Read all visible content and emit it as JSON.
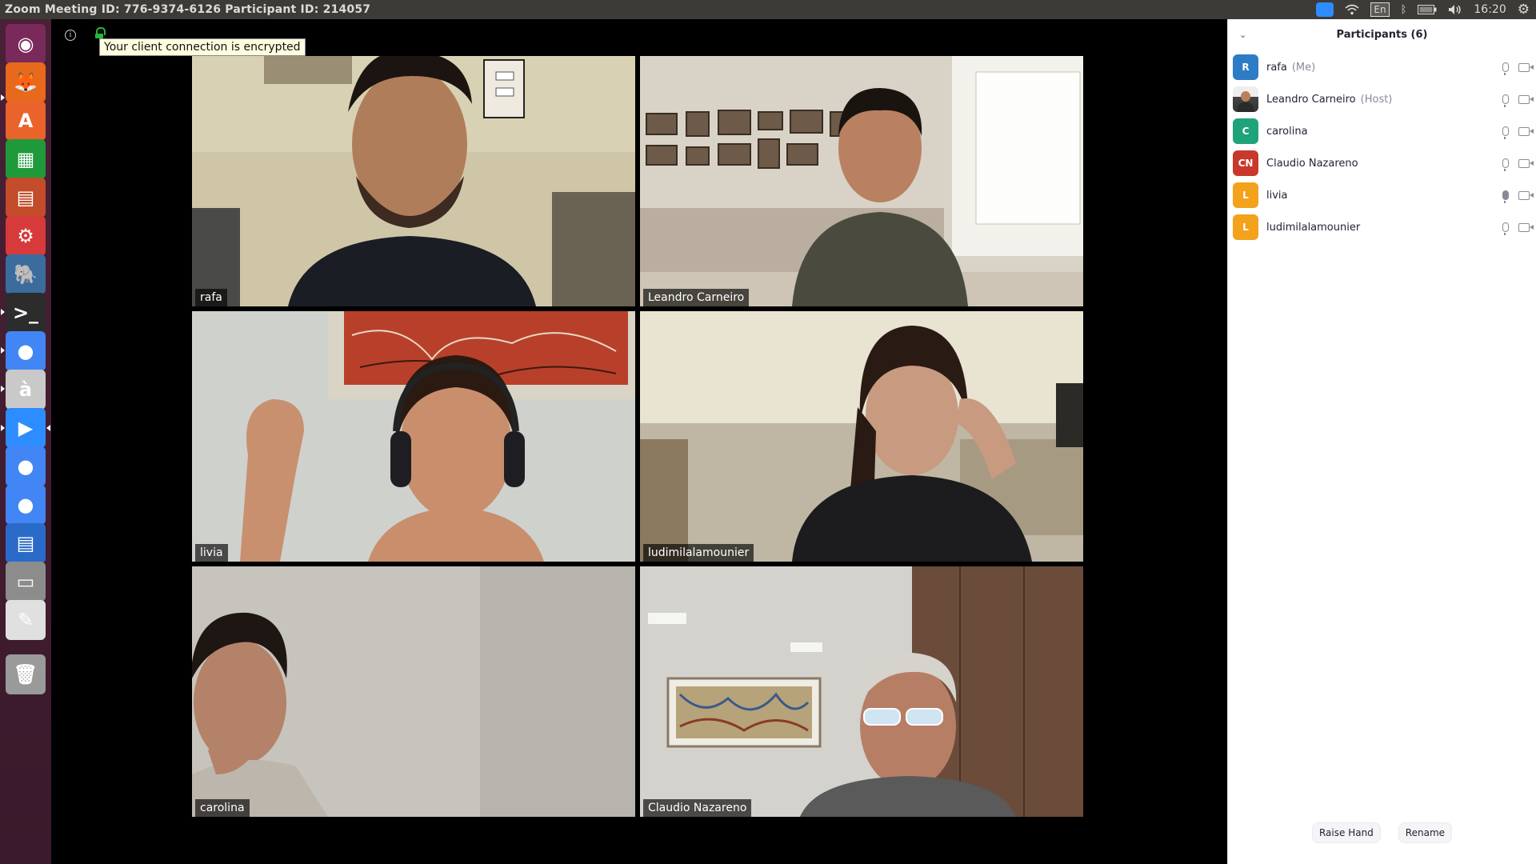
{
  "window": {
    "title": "Zoom Meeting ID: 776-9374-6126 Participant ID: 214057"
  },
  "system_tray": {
    "language": "En",
    "clock": "16:20",
    "icons": [
      "zoom-tray-icon",
      "wifi-icon",
      "keyboard-language-icon",
      "bluetooth-icon",
      "battery-icon",
      "volume-icon",
      "settings-gear-icon"
    ]
  },
  "launcher": {
    "items": [
      {
        "name": "ubuntu-dash",
        "glyph": "◉",
        "color": "#7a2a5a"
      },
      {
        "name": "firefox",
        "glyph": "🦊",
        "color": "#e8691b"
      },
      {
        "name": "software-center",
        "glyph": "A",
        "color": "#e9632b"
      },
      {
        "name": "libreoffice-calc",
        "glyph": "▦",
        "color": "#1f9a3a"
      },
      {
        "name": "libreoffice-impress",
        "glyph": "▤",
        "color": "#c34c2a"
      },
      {
        "name": "system-settings",
        "glyph": "⚙",
        "color": "#d63a3a"
      },
      {
        "name": "pgadmin",
        "glyph": "🐘",
        "color": "#3a6c9e"
      },
      {
        "name": "terminal",
        "glyph": ">_",
        "color": "#2c2c2c"
      },
      {
        "name": "chrome",
        "glyph": "●",
        "color": "#4285f4"
      },
      {
        "name": "character-map",
        "glyph": "à",
        "color": "#c9c9c9"
      },
      {
        "name": "zoom",
        "glyph": "▶",
        "color": "#2d8cff"
      },
      {
        "name": "chrome-2",
        "glyph": "●",
        "color": "#4285f4"
      },
      {
        "name": "chrome-3",
        "glyph": "●",
        "color": "#4285f4"
      },
      {
        "name": "libreoffice-writer",
        "glyph": "▤",
        "color": "#2a6ac9"
      },
      {
        "name": "files",
        "glyph": "▭",
        "color": "#8c8c8c"
      },
      {
        "name": "text-editor",
        "glyph": "✎",
        "color": "#e0e0e0"
      },
      {
        "name": "trash",
        "glyph": "🗑",
        "color": "#9a9a9a"
      }
    ]
  },
  "meeting": {
    "encrypted_tooltip": "Your client connection is encrypted",
    "tiles": [
      {
        "name": "rafa",
        "active": false
      },
      {
        "name": "Leandro Carneiro",
        "active": false
      },
      {
        "name": "livia",
        "active": true
      },
      {
        "name": "ludimilalamounier",
        "active": false
      },
      {
        "name": "carolina",
        "active": false
      },
      {
        "name": "Claudio Nazareno",
        "active": false
      }
    ]
  },
  "participants": {
    "header": "Participants (6)",
    "list": [
      {
        "initials": "R",
        "name": "rafa",
        "tag": "(Me)",
        "avatar_color": "#2d7cc5",
        "photo": false
      },
      {
        "initials": "",
        "name": "Leandro Carneiro",
        "tag": "(Host)",
        "avatar_color": "#444444",
        "photo": true
      },
      {
        "initials": "C",
        "name": "carolina",
        "tag": "",
        "avatar_color": "#1fa37a",
        "photo": false
      },
      {
        "initials": "CN",
        "name": "Claudio Nazareno",
        "tag": "",
        "avatar_color": "#c8382b",
        "photo": false
      },
      {
        "initials": "L",
        "name": "livia",
        "tag": "",
        "avatar_color": "#f3a21c",
        "photo": false
      },
      {
        "initials": "L",
        "name": "ludimilalamounier",
        "tag": "",
        "avatar_color": "#f3a21c",
        "photo": false
      }
    ],
    "footer": {
      "raise_hand": "Raise Hand",
      "rename": "Rename"
    }
  }
}
